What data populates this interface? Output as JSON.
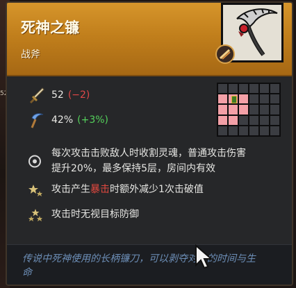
{
  "item": {
    "name": "死神之镰",
    "type": "战斧",
    "left_edge_label": "52"
  },
  "stats": {
    "attack": {
      "value": "52",
      "delta": "(−2)"
    },
    "crit": {
      "value": "42%",
      "delta": "(+3%)"
    }
  },
  "range_grid": {
    "rows": [
      [
        "n",
        "n",
        "n",
        "n",
        "n",
        "n"
      ],
      [
        "p",
        "c",
        "p",
        "n",
        "n",
        "n"
      ],
      [
        "p",
        "p",
        "p",
        "n",
        "n",
        "n"
      ],
      [
        "p",
        "p",
        "n",
        "n",
        "n",
        "n"
      ],
      [
        "n",
        "n",
        "n",
        "n",
        "n",
        "n"
      ]
    ]
  },
  "effects": {
    "main_line1": "每次攻击击败敌人时收割灵魂，普通攻击伤害",
    "main_line2": "提升20%，最多保持5层，房间内有效",
    "crit_pre": "攻击产生",
    "crit_highlight": "暴击",
    "crit_post": "时额外减少1次击破值",
    "ignore_defense": "攻击时无视目标防御"
  },
  "lore": "传说中死神使用的长柄镰刀，可以剥夺对方的时间与生命",
  "colors": {
    "header": "#c98822",
    "negative": "#e04848",
    "positive": "#54d15b",
    "highlight": "#e3483f",
    "lore": "#6d8fb8"
  }
}
